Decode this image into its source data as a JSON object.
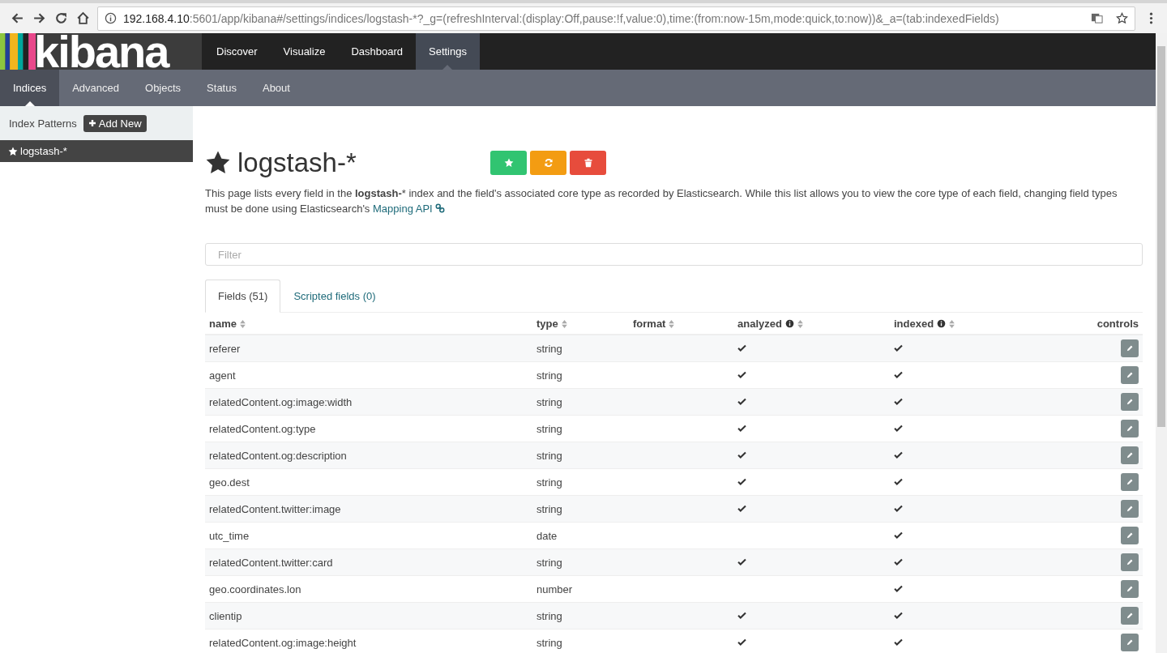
{
  "browser": {
    "url_host": "192.168.4.10",
    "url_rest": ":5601/app/kibana#/settings/indices/logstash-*?_g=(refreshInterval:(display:Off,pause:!f,value:0),time:(from:now-15m,mode:quick,to:now))&_a=(tab:indexedFields)"
  },
  "app": {
    "logo": "kibana"
  },
  "nav": [
    {
      "label": "Discover",
      "selected": false
    },
    {
      "label": "Visualize",
      "selected": false
    },
    {
      "label": "Dashboard",
      "selected": false
    },
    {
      "label": "Settings",
      "selected": true
    }
  ],
  "subnav": [
    {
      "label": "Indices",
      "selected": true
    },
    {
      "label": "Advanced",
      "selected": false
    },
    {
      "label": "Objects",
      "selected": false
    },
    {
      "label": "Status",
      "selected": false
    },
    {
      "label": "About",
      "selected": false
    }
  ],
  "sidebar": {
    "title": "Index Patterns",
    "add_button": "Add New",
    "items": [
      {
        "label": "logstash-*",
        "selected": true,
        "default": true
      }
    ]
  },
  "index": {
    "title": "logstash-*",
    "description": "This page lists every field in the **logstash-*** index and the field's associated core type as recorded by Elasticsearch. While this list allows you to view the core type of each field, changing field types must be done using Elasticsearch's",
    "link": "Mapping API"
  },
  "filter": {
    "placeholder": "Filter"
  },
  "tabs": [
    {
      "label": "Fields (51)",
      "selected": true
    },
    {
      "label": "Scripted fields (0)",
      "selected": false
    }
  ],
  "table": {
    "columns": [
      {
        "label": "name",
        "sortable": true,
        "info": false
      },
      {
        "label": "type",
        "sortable": true,
        "info": false
      },
      {
        "label": "format",
        "sortable": true,
        "info": false
      },
      {
        "label": "analyzed",
        "sortable": true,
        "info": true
      },
      {
        "label": "indexed",
        "sortable": true,
        "info": true
      },
      {
        "label": "controls",
        "sortable": false,
        "info": false
      }
    ],
    "rows": [
      {
        "name": "referer",
        "type": "string",
        "analyzed": true,
        "indexed": true
      },
      {
        "name": "agent",
        "type": "string",
        "analyzed": true,
        "indexed": true
      },
      {
        "name": "relatedContent.og:image:width",
        "type": "string",
        "analyzed": true,
        "indexed": true
      },
      {
        "name": "relatedContent.og:type",
        "type": "string",
        "analyzed": true,
        "indexed": true
      },
      {
        "name": "relatedContent.og:description",
        "type": "string",
        "analyzed": true,
        "indexed": true
      },
      {
        "name": "geo.dest",
        "type": "string",
        "analyzed": true,
        "indexed": true
      },
      {
        "name": "relatedContent.twitter:image",
        "type": "string",
        "analyzed": true,
        "indexed": true
      },
      {
        "name": "utc_time",
        "type": "date",
        "analyzed": false,
        "indexed": true
      },
      {
        "name": "relatedContent.twitter:card",
        "type": "string",
        "analyzed": true,
        "indexed": true
      },
      {
        "name": "geo.coordinates.lon",
        "type": "number",
        "analyzed": false,
        "indexed": true
      },
      {
        "name": "clientip",
        "type": "string",
        "analyzed": true,
        "indexed": true
      },
      {
        "name": "relatedContent.og:image:height",
        "type": "string",
        "analyzed": true,
        "indexed": true
      }
    ]
  }
}
